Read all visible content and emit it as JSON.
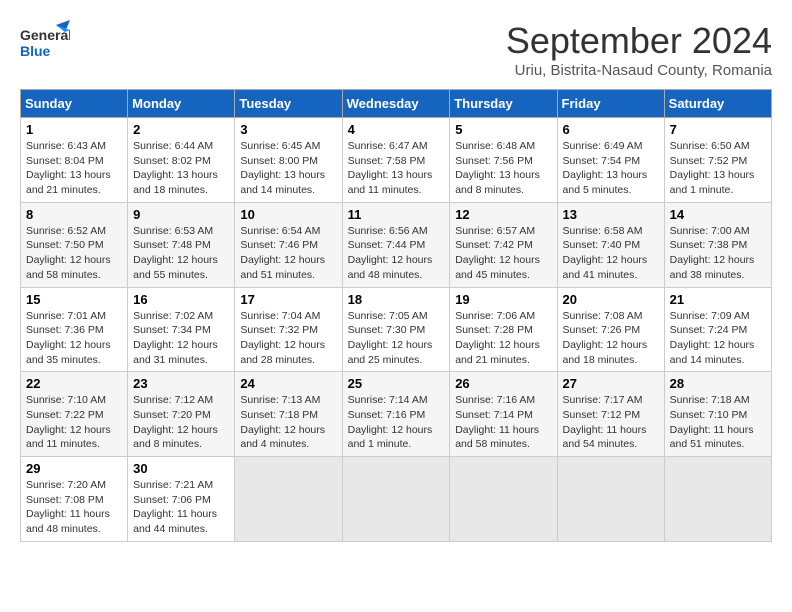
{
  "header": {
    "logo_line1": "General",
    "logo_line2": "Blue",
    "month": "September 2024",
    "location": "Uriu, Bistrita-Nasaud County, Romania"
  },
  "days_of_week": [
    "Sunday",
    "Monday",
    "Tuesday",
    "Wednesday",
    "Thursday",
    "Friday",
    "Saturday"
  ],
  "weeks": [
    [
      {
        "day": "1",
        "info": "Sunrise: 6:43 AM\nSunset: 8:04 PM\nDaylight: 13 hours\nand 21 minutes."
      },
      {
        "day": "2",
        "info": "Sunrise: 6:44 AM\nSunset: 8:02 PM\nDaylight: 13 hours\nand 18 minutes."
      },
      {
        "day": "3",
        "info": "Sunrise: 6:45 AM\nSunset: 8:00 PM\nDaylight: 13 hours\nand 14 minutes."
      },
      {
        "day": "4",
        "info": "Sunrise: 6:47 AM\nSunset: 7:58 PM\nDaylight: 13 hours\nand 11 minutes."
      },
      {
        "day": "5",
        "info": "Sunrise: 6:48 AM\nSunset: 7:56 PM\nDaylight: 13 hours\nand 8 minutes."
      },
      {
        "day": "6",
        "info": "Sunrise: 6:49 AM\nSunset: 7:54 PM\nDaylight: 13 hours\nand 5 minutes."
      },
      {
        "day": "7",
        "info": "Sunrise: 6:50 AM\nSunset: 7:52 PM\nDaylight: 13 hours\nand 1 minute."
      }
    ],
    [
      {
        "day": "8",
        "info": "Sunrise: 6:52 AM\nSunset: 7:50 PM\nDaylight: 12 hours\nand 58 minutes."
      },
      {
        "day": "9",
        "info": "Sunrise: 6:53 AM\nSunset: 7:48 PM\nDaylight: 12 hours\nand 55 minutes."
      },
      {
        "day": "10",
        "info": "Sunrise: 6:54 AM\nSunset: 7:46 PM\nDaylight: 12 hours\nand 51 minutes."
      },
      {
        "day": "11",
        "info": "Sunrise: 6:56 AM\nSunset: 7:44 PM\nDaylight: 12 hours\nand 48 minutes."
      },
      {
        "day": "12",
        "info": "Sunrise: 6:57 AM\nSunset: 7:42 PM\nDaylight: 12 hours\nand 45 minutes."
      },
      {
        "day": "13",
        "info": "Sunrise: 6:58 AM\nSunset: 7:40 PM\nDaylight: 12 hours\nand 41 minutes."
      },
      {
        "day": "14",
        "info": "Sunrise: 7:00 AM\nSunset: 7:38 PM\nDaylight: 12 hours\nand 38 minutes."
      }
    ],
    [
      {
        "day": "15",
        "info": "Sunrise: 7:01 AM\nSunset: 7:36 PM\nDaylight: 12 hours\nand 35 minutes."
      },
      {
        "day": "16",
        "info": "Sunrise: 7:02 AM\nSunset: 7:34 PM\nDaylight: 12 hours\nand 31 minutes."
      },
      {
        "day": "17",
        "info": "Sunrise: 7:04 AM\nSunset: 7:32 PM\nDaylight: 12 hours\nand 28 minutes."
      },
      {
        "day": "18",
        "info": "Sunrise: 7:05 AM\nSunset: 7:30 PM\nDaylight: 12 hours\nand 25 minutes."
      },
      {
        "day": "19",
        "info": "Sunrise: 7:06 AM\nSunset: 7:28 PM\nDaylight: 12 hours\nand 21 minutes."
      },
      {
        "day": "20",
        "info": "Sunrise: 7:08 AM\nSunset: 7:26 PM\nDaylight: 12 hours\nand 18 minutes."
      },
      {
        "day": "21",
        "info": "Sunrise: 7:09 AM\nSunset: 7:24 PM\nDaylight: 12 hours\nand 14 minutes."
      }
    ],
    [
      {
        "day": "22",
        "info": "Sunrise: 7:10 AM\nSunset: 7:22 PM\nDaylight: 12 hours\nand 11 minutes."
      },
      {
        "day": "23",
        "info": "Sunrise: 7:12 AM\nSunset: 7:20 PM\nDaylight: 12 hours\nand 8 minutes."
      },
      {
        "day": "24",
        "info": "Sunrise: 7:13 AM\nSunset: 7:18 PM\nDaylight: 12 hours\nand 4 minutes."
      },
      {
        "day": "25",
        "info": "Sunrise: 7:14 AM\nSunset: 7:16 PM\nDaylight: 12 hours\nand 1 minute."
      },
      {
        "day": "26",
        "info": "Sunrise: 7:16 AM\nSunset: 7:14 PM\nDaylight: 11 hours\nand 58 minutes."
      },
      {
        "day": "27",
        "info": "Sunrise: 7:17 AM\nSunset: 7:12 PM\nDaylight: 11 hours\nand 54 minutes."
      },
      {
        "day": "28",
        "info": "Sunrise: 7:18 AM\nSunset: 7:10 PM\nDaylight: 11 hours\nand 51 minutes."
      }
    ],
    [
      {
        "day": "29",
        "info": "Sunrise: 7:20 AM\nSunset: 7:08 PM\nDaylight: 11 hours\nand 48 minutes."
      },
      {
        "day": "30",
        "info": "Sunrise: 7:21 AM\nSunset: 7:06 PM\nDaylight: 11 hours\nand 44 minutes."
      },
      {
        "day": "",
        "info": ""
      },
      {
        "day": "",
        "info": ""
      },
      {
        "day": "",
        "info": ""
      },
      {
        "day": "",
        "info": ""
      },
      {
        "day": "",
        "info": ""
      }
    ]
  ]
}
